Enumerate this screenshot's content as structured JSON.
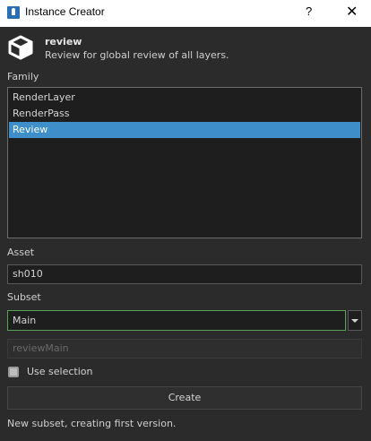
{
  "window": {
    "title": "Instance Creator",
    "help_label": "?",
    "close_label": "✕"
  },
  "header": {
    "title": "review",
    "description": "Review for global review of all layers.",
    "icon": "cube-icon"
  },
  "family": {
    "label": "Family",
    "items": [
      "RenderLayer",
      "RenderPass",
      "Review"
    ],
    "selected": "Review"
  },
  "asset": {
    "label": "Asset",
    "value": "sh010"
  },
  "subset": {
    "label": "Subset",
    "value": "Main",
    "result": "reviewMain"
  },
  "use_selection": {
    "label": "Use selection",
    "checked": true
  },
  "create_button": {
    "label": "Create"
  },
  "status": {
    "text": "New subset, creating first version."
  },
  "colors": {
    "accent": "#3d8ec9",
    "background": "#2b2b2b"
  }
}
